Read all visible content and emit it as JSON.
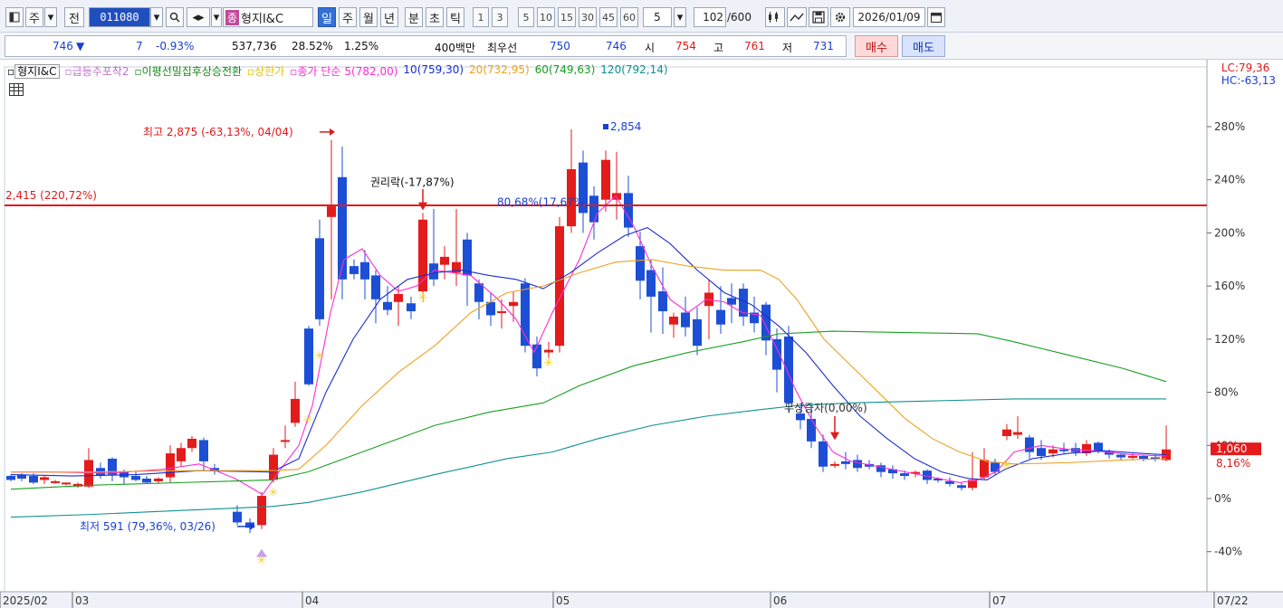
{
  "toolbar": {
    "interval_label": "주",
    "jeon_label": "전",
    "stock_code": "011080",
    "stock_badge": "종",
    "stock_name": "형지I&C",
    "periods": [
      "일",
      "주",
      "월",
      "년",
      "분",
      "초",
      "틱"
    ],
    "active_period": "일",
    "unit_buttons": [
      "1",
      "3",
      "5",
      "10",
      "15",
      "30",
      "45",
      "60"
    ],
    "unit_select": "5",
    "count": "102",
    "count_max": "/600",
    "date": "2026/01/09"
  },
  "quote": {
    "price": "746",
    "arrow": "▼",
    "change": "7",
    "change_pct": "-0.93%",
    "volume": "537,736",
    "turnover_pct": "28.52%",
    "ratio": "1.25%",
    "amount": "400백만",
    "best_label": "최우선",
    "best_ask": "750",
    "best_bid": "746",
    "open_label": "시",
    "open": "754",
    "high_label": "고",
    "high": "761",
    "low_label": "저",
    "low": "731",
    "buy_label": "매수",
    "sell_label": "매도"
  },
  "legend": {
    "stock": "형지I&C",
    "ind1": "급등주포착2",
    "ind2": "이평선밀집후상승전환",
    "ind3": "상한가",
    "ma_title": "종가 단순",
    "ma5": "5(782,00)",
    "ma10": "10(759,30)",
    "ma20": "20(732,95)",
    "ma60": "60(749,63)",
    "ma120": "120(792,14)"
  },
  "lc_hc": {
    "lc": "LC:79,36",
    "hc": "HC:-63,13"
  },
  "annotations": {
    "high": "최고 2,875 (-63,13%, 04/04)",
    "low": "최저 591 (79,36%, 03/26)",
    "hline": "2,415 (220,72%)",
    "rights": "권리락(-17,87%)",
    "rights2": "80,68%(17,67%)",
    "peak": "2,854",
    "bonus": "무상증자(0,00%)"
  },
  "price_tag": {
    "price": "1,060",
    "pct": "8,16%"
  },
  "chart_data": {
    "type": "candlestick",
    "yaxis_right": [
      "280%",
      "240%",
      "200%",
      "160%",
      "120%",
      "80%",
      "40%",
      "0%",
      "-40%"
    ],
    "xaxis": [
      "2025/02",
      "03",
      "04",
      "05",
      "06",
      "07",
      "07/22"
    ],
    "colors": {
      "up": "#e31b1b",
      "down": "#1c4fd6",
      "ma5": "#ff2bd6",
      "ma10": "#1b2fd0",
      "ma20": "#f0a020",
      "ma60": "#18a020",
      "ma120": "#0f9090",
      "hline": "#e01a1a"
    }
  }
}
